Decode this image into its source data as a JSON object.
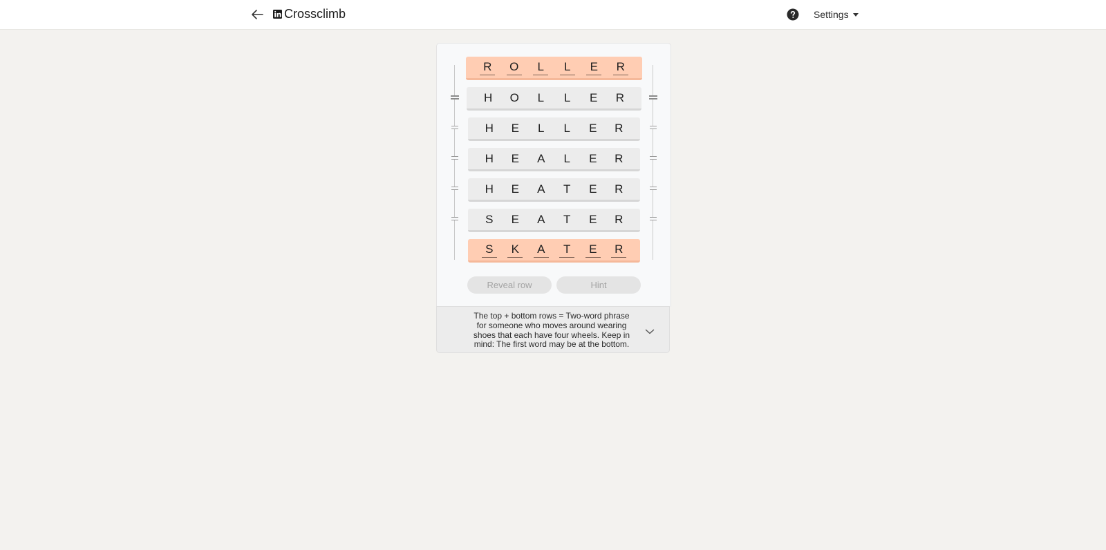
{
  "header": {
    "title": "Crossclimb",
    "back_icon": "back-arrow-icon",
    "logo_icon": "linkedin-logo-icon",
    "help_icon": "help-circle-icon",
    "settings_label": "Settings"
  },
  "board": {
    "rows": [
      {
        "letters": [
          "R",
          "O",
          "L",
          "L",
          "E",
          "R"
        ],
        "locked": true
      },
      {
        "letters": [
          "H",
          "O",
          "L",
          "L",
          "E",
          "R"
        ],
        "locked": false
      },
      {
        "letters": [
          "H",
          "E",
          "L",
          "L",
          "E",
          "R"
        ],
        "locked": false
      },
      {
        "letters": [
          "H",
          "E",
          "A",
          "L",
          "E",
          "R"
        ],
        "locked": false
      },
      {
        "letters": [
          "H",
          "E",
          "A",
          "T",
          "E",
          "R"
        ],
        "locked": false
      },
      {
        "letters": [
          "S",
          "E",
          "A",
          "T",
          "E",
          "R"
        ],
        "locked": false
      },
      {
        "letters": [
          "S",
          "K",
          "A",
          "T",
          "E",
          "R"
        ],
        "locked": true
      }
    ],
    "reveal_row_label": "Reveal row",
    "hint_label": "Hint"
  },
  "clue": {
    "text": "The top + bottom rows = Two-word phrase for someone who moves around wearing shoes that each have four wheels. Keep in mind: The first word may be at the bottom."
  },
  "colors": {
    "locked_row": "#ffcdb3",
    "normal_row": "#ececec",
    "page_background": "#f3f2ef"
  }
}
